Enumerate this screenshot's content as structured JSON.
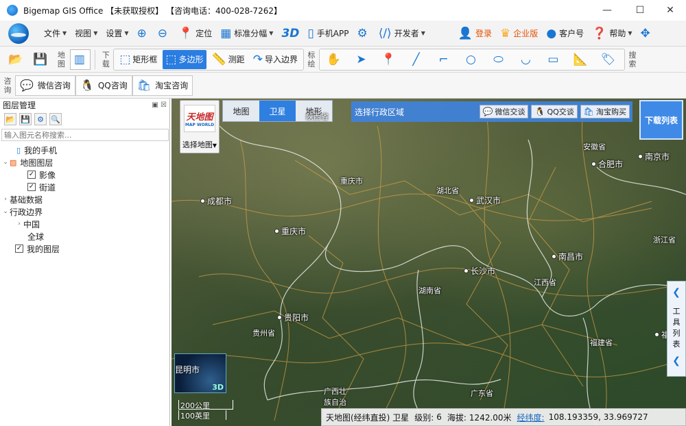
{
  "window": {
    "title": "Bigemap GIS Office 【未获取授权】 【咨询电话：400-028-7262】",
    "min": "—",
    "max": "☐",
    "close": "✕"
  },
  "menubar": {
    "file": "文件",
    "view": "视图",
    "settings": "设置",
    "locate": "定位",
    "tile": "标准分幅",
    "three_d": "3D",
    "mobile": "手机APP",
    "developer": "开发者",
    "login": "登录",
    "enterprise": "企业版",
    "account": "客户号",
    "help": "帮助"
  },
  "toolbar": {
    "map_label": "地图",
    "download_label": "下载",
    "rect": "矩形框",
    "polygon": "多边形",
    "measure": "测距",
    "import_border": "导入边界",
    "draw_label": "标绘",
    "search_label": "搜索"
  },
  "consult": {
    "label": "咨询",
    "wechat": "微信咨询",
    "qq": "QQ咨询",
    "taobao": "淘宝咨询"
  },
  "layers": {
    "title": "图层管理",
    "search_placeholder": "输入图元名称搜索...",
    "tree": {
      "phone": "我的手机",
      "map_layers": "地图图层",
      "imagery": "影像",
      "streets": "街道",
      "base_data": "基础数据",
      "admin": "行政边界",
      "china": "中国",
      "global": "全球",
      "my_layers": "我的图层"
    }
  },
  "map": {
    "select_map": "选择地图",
    "thumb_text": "天地图",
    "thumb_sub": "MAP WORLD",
    "types": [
      "地图",
      "卫星",
      "地形"
    ],
    "active_type": "卫星",
    "region_label": "选择行政区域",
    "wechat_chat": "微信交谈",
    "qq_chat": "QQ交谈",
    "taobao_buy": "淘宝购买",
    "download_list": "下载列表",
    "tool_list": "工具列表",
    "minimap_label": "昆明市",
    "minimap_3d": "3D",
    "scale_km": "200公里",
    "scale_mi": "100英里",
    "cities": {
      "chengdu": "成都市",
      "chongqing": "重庆市",
      "wuhan": "武汉市",
      "hefei": "合肥市",
      "nanjing": "南京市",
      "changsha": "长沙市",
      "nanchang": "南昌市",
      "guiyang": "贵阳市",
      "fuzhou": "福州市"
    },
    "provinces": {
      "chongqing": "重庆市",
      "hubei": "湖北省",
      "anhui": "安徽省",
      "hunan": "湖南省",
      "jiangxi": "江西省",
      "zhejiang": "浙江省",
      "guizhou": "贵州省",
      "fujian": "福建省",
      "guangxi": "广西壮族自治区",
      "guangdong": "广东省",
      "shaanxi": "陕西省"
    }
  },
  "status": {
    "source": "天地图(经纬直投) 卫星",
    "level_label": "级别:",
    "level": "6",
    "altitude_label": "海拔:",
    "altitude": "1242.00米",
    "coord_link": "经纬度:",
    "coords": "108.193359, 33.969727"
  }
}
